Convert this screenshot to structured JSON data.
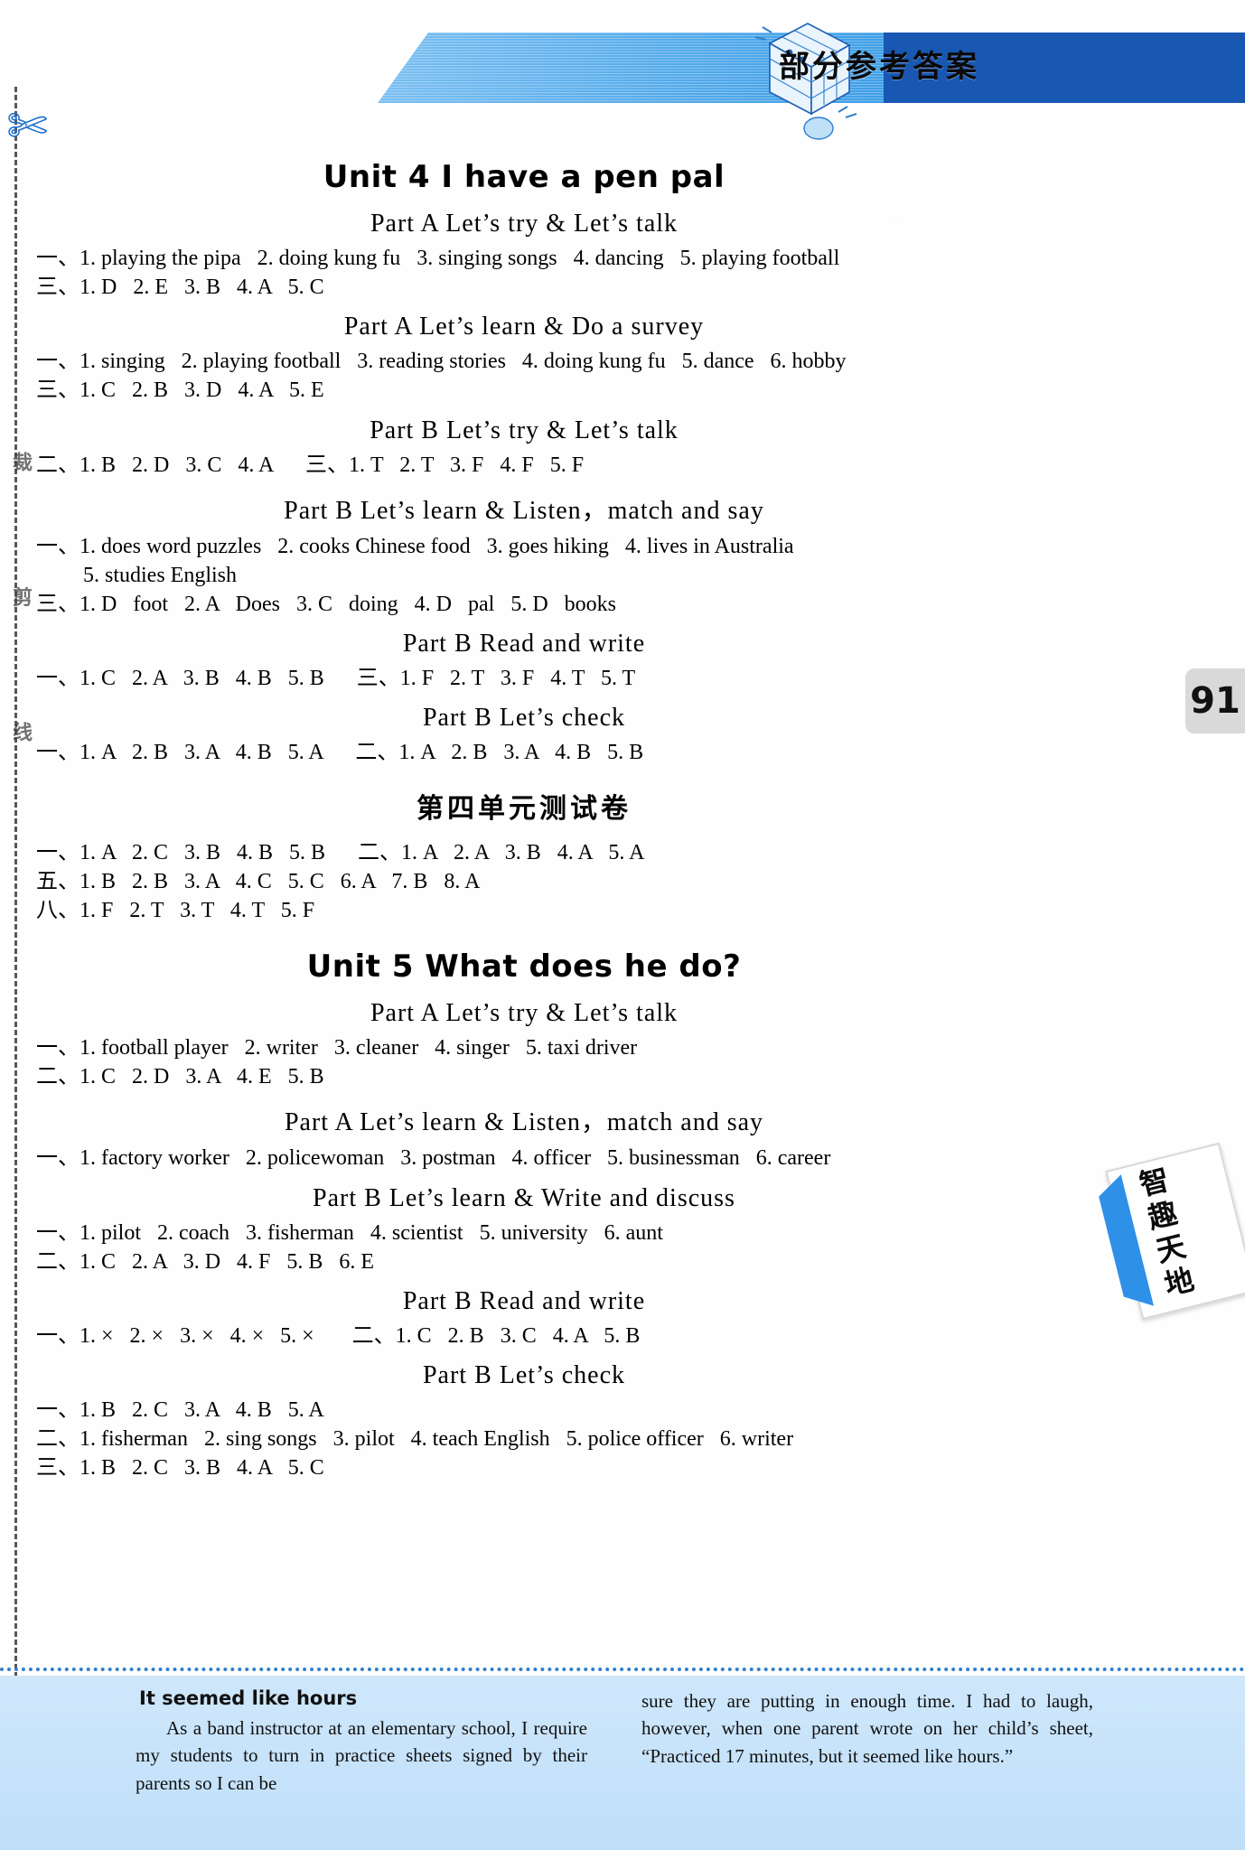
{
  "header": {
    "banner_title": "部分参考答案",
    "cube_icon": "rubiks-cube-icon"
  },
  "page_number": "91",
  "side_marks": {
    "scissors_icon": "scissors-icon",
    "vertical_text": "裁 剪 线"
  },
  "units": [
    {
      "title": "Unit 4    I have a pen pal",
      "sections": [
        {
          "part": "Part A    Let’s try  &  Let’s talk",
          "lines": [
            "一、1. playing the pipa   2. doing kung fu   3. singing songs   4. dancing   5. playing football",
            "三、1. D   2. E   3. B   4. A   5. C"
          ]
        },
        {
          "part": "Part A    Let’s learn  &  Do a survey",
          "lines": [
            "一、1. singing   2. playing football   3. reading stories   4. doing kung fu   5. dance   6. hobby",
            "三、1. C   2. B   3. D   4. A   5. E"
          ]
        },
        {
          "part": "Part B    Let’s try  &  Let’s talk",
          "lines": [
            "二、1. B   2. D   3. C   4. A      三、1. T   2. T   3. F   4. F   5. F"
          ]
        },
        {
          "part": "Part B    Let’s learn  &  Listen，match and say",
          "lines": [
            "一、1. does word puzzles   2. cooks Chinese food   3. goes hiking   4. lives in Australia",
            "5. studies English",
            "三、1. D   foot   2. A   Does   3. C   doing   4. D   pal   5. D   books"
          ]
        },
        {
          "part": "Part B   Read and write",
          "lines": [
            "一、1. C   2. A   3. B   4. B   5. B      三、1. F   2. T   3. F   4. T   5. T"
          ]
        },
        {
          "part": "Part B    Let’s check",
          "lines": [
            "一、1. A   2. B   3. A   4. B   5. A      二、1. A   2. B   3. A   4. B   5. B"
          ]
        }
      ],
      "test": {
        "title": "第四单元测试卷",
        "lines": [
          "一、1. A   2. C   3. B   4. B   5. B      二、1. A   2. A   3. B   4. A   5. A",
          "五、1. B   2. B   3. A   4. C   5. C   6. A   7. B   8. A",
          "八、1. F   2. T   3. T   4. T   5. F"
        ]
      }
    },
    {
      "title": "Unit 5    What does he do?",
      "sections": [
        {
          "part": "Part A    Let’s try  &  Let’s talk",
          "lines": [
            "一、1. football player   2. writer   3. cleaner   4. singer   5. taxi driver",
            "二、1. C   2. D   3. A   4. E   5. B"
          ]
        },
        {
          "part": "Part A    Let’s learn  &  Listen，match and say",
          "lines": [
            "一、1. factory worker   2. policewoman   3. postman   4. officer   5. businessman   6. career"
          ]
        },
        {
          "part": "Part B    Let’s learn  &  Write and discuss",
          "lines": [
            "一、1. pilot   2. coach   3. fisherman   4. scientist   5. university   6. aunt",
            "二、1. C   2. A   3. D   4. F   5. B   6. E"
          ]
        },
        {
          "part": "Part B    Read and write",
          "lines": [
            "一、1. ×   2. ×   3. ×   4. ×   5. ×       二、1. C   2. B   3. C   4. A   5. B"
          ]
        },
        {
          "part": "Part B    Let’s check",
          "lines": [
            "一、1. B   2. C   3. A   4. B   5. A",
            "二、1. fisherman   2. sing songs   3. pilot   4. teach English   5. police officer   6. writer",
            "三、1. B   2. C   3. B   4. A   5. C"
          ]
        }
      ]
    }
  ],
  "fun_corner": {
    "tab_text": "智趣天地",
    "story_title": "It seemed like hours",
    "left_paragraph": "As a band instructor at an elementary school, I require my students to turn in practice sheets signed by their parents so I can be",
    "right_paragraph": "sure they are putting in enough time. I had to laugh, however, when one parent wrote on her child’s sheet, “Practiced 17 minutes, but it seemed like hours.”"
  }
}
